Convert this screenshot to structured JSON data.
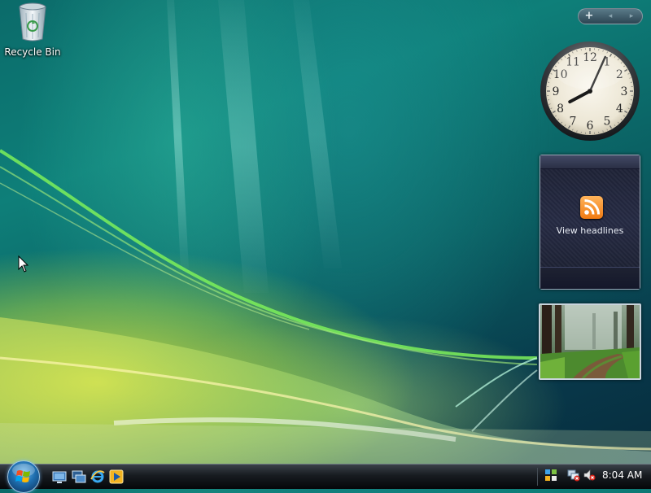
{
  "desktop": {
    "icons": [
      {
        "label": "Recycle Bin",
        "icon": "recycle-bin-icon"
      }
    ]
  },
  "sidebar": {
    "controls": {
      "add_label": "+",
      "previous_label": "◂",
      "next_label": "▸"
    },
    "clock": {
      "numerals": [
        "12",
        "1",
        "2",
        "3",
        "4",
        "5",
        "6",
        "7",
        "8",
        "9",
        "10",
        "11"
      ],
      "hour": 8,
      "minute": 4
    },
    "feed": {
      "icon": "rss-feed-icon",
      "headlines_label": "View headlines"
    },
    "slideshow": {
      "image": "forest-path-photo"
    }
  },
  "taskbar": {
    "start_icon": "windows-start-orb-icon",
    "quick_launch": [
      {
        "icon": "show-desktop-icon"
      },
      {
        "icon": "switch-windows-icon"
      },
      {
        "icon": "internet-explorer-icon"
      },
      {
        "icon": "media-player-icon"
      }
    ],
    "tray": {
      "icons": [
        "windows-sidebar-icon",
        "network-disconnected-icon",
        "volume-muted-icon"
      ],
      "time": "8:04 AM"
    }
  },
  "colors": {
    "accent_orange": "#f07a12",
    "taskbar_dark": "#05070a",
    "desktop_teal": "#0e7f79"
  }
}
